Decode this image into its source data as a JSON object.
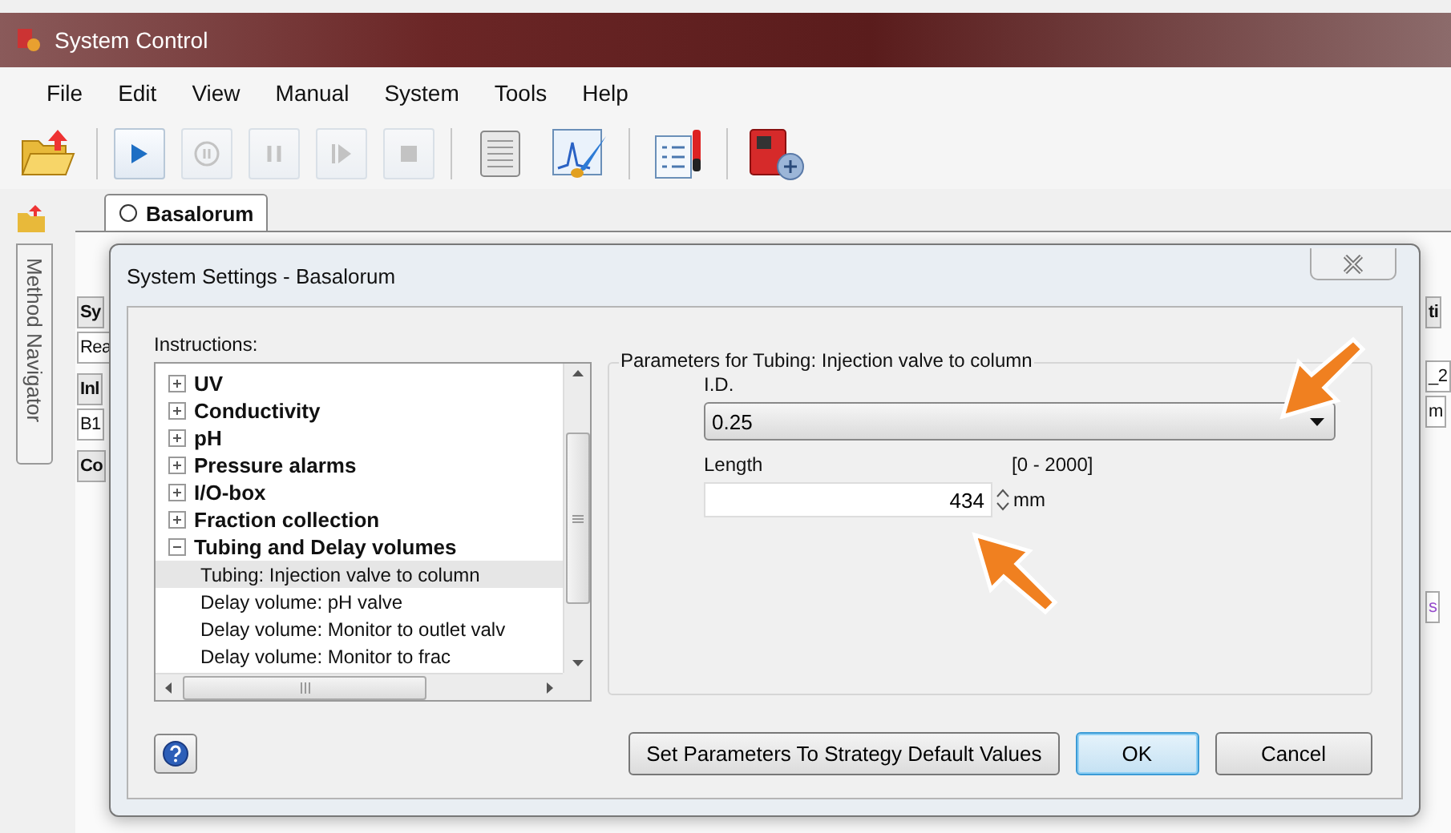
{
  "window": {
    "title": "System Control"
  },
  "menu": [
    "File",
    "Edit",
    "View",
    "Manual",
    "System",
    "Tools",
    "Help"
  ],
  "toolbar": [
    {
      "kind": "open",
      "disabled": false
    },
    {
      "kind": "separator"
    },
    {
      "kind": "run",
      "disabled": false
    },
    {
      "kind": "hold",
      "disabled": true
    },
    {
      "kind": "pause",
      "disabled": true
    },
    {
      "kind": "continue",
      "disabled": true
    },
    {
      "kind": "stop",
      "disabled": true
    },
    {
      "kind": "separator"
    },
    {
      "kind": "log",
      "disabled": false
    },
    {
      "kind": "chart",
      "disabled": false
    },
    {
      "kind": "separator"
    },
    {
      "kind": "checklist",
      "disabled": false
    },
    {
      "kind": "separator"
    },
    {
      "kind": "device",
      "disabled": false
    }
  ],
  "tabs": [
    {
      "label": "Basalorum",
      "selected": true
    }
  ],
  "side_tab": {
    "label": "Method Navigator"
  },
  "background_left": [
    {
      "text": "Sy",
      "kind": "header"
    },
    {
      "text": "Rea",
      "kind": "value"
    },
    {
      "text": "Inl",
      "kind": "header"
    },
    {
      "text": "B1",
      "kind": "value"
    },
    {
      "text": "Co",
      "kind": "header"
    }
  ],
  "background_right": [
    {
      "text": "ti",
      "kind": "header"
    },
    {
      "text": "_2",
      "kind": "value"
    },
    {
      "text": "m",
      "kind": "value"
    },
    {
      "text": "s",
      "kind": "link"
    }
  ],
  "dialog": {
    "title": "System Settings - Basalorum",
    "instructions_label": "Instructions:",
    "tree": [
      {
        "label": "UV",
        "expanded": false
      },
      {
        "label": "Conductivity",
        "expanded": false
      },
      {
        "label": "pH",
        "expanded": false
      },
      {
        "label": "Pressure alarms",
        "expanded": false
      },
      {
        "label": "I/O-box",
        "expanded": false
      },
      {
        "label": "Fraction collection",
        "expanded": false
      },
      {
        "label": "Tubing and Delay volumes",
        "expanded": true,
        "children": [
          {
            "label": "Tubing: Injection valve to column",
            "selected": true
          },
          {
            "label": "Delay volume: pH valve",
            "selected": false
          },
          {
            "label": "Delay volume: Monitor to outlet valv",
            "selected": false
          },
          {
            "label": "Delay volume: Monitor to frac",
            "selected": false
          }
        ]
      }
    ],
    "group_title": "Parameters for Tubing: Injection valve to column",
    "id_label": "I.D.",
    "id_value": "0.25",
    "length_label": "Length",
    "length_range": "[0 - 2000]",
    "length_value": "434",
    "length_unit": "mm",
    "buttons": [
      {
        "label": "Set Parameters To Strategy Default Values",
        "default": false
      },
      {
        "label": "OK",
        "default": true
      },
      {
        "label": "Cancel",
        "default": false
      }
    ]
  }
}
